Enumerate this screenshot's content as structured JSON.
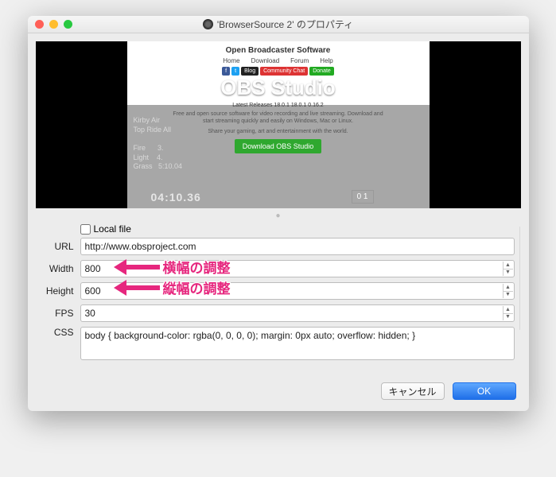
{
  "titlebar": {
    "title": "'BrowserSource 2' のプロパティ"
  },
  "preview": {
    "heading": "Open Broadcaster Software",
    "nav": [
      "Home",
      "Download",
      "Forum",
      "Help"
    ],
    "badges": [
      "f",
      "t",
      "Blog",
      "Community Chat",
      "Donate"
    ],
    "hero": "OBS Studio",
    "releases": "Latest Releases   18.0.1   18.0.1   0.16.2",
    "desc1": "Free and open source software for video recording and live streaming. Download and start streaming quickly and easily on Windows, Mac or Linux.",
    "desc2": "Share your gaming, art and entertainment with the world.",
    "download": "Download OBS Studio",
    "bg_lines": "Kirby Air\nTop Ride All\n\nFire      3.\nLight    4.\nGrass   5:10.04",
    "bg_time": "04:10.36",
    "bg_score": "0 1"
  },
  "form": {
    "local_file_label": "Local file",
    "labels": {
      "url": "URL",
      "width": "Width",
      "height": "Height",
      "fps": "FPS",
      "css": "CSS"
    },
    "url": "http://www.obsproject.com",
    "width": "800",
    "height": "600",
    "fps": "30",
    "css": "body { background-color: rgba(0, 0, 0, 0); margin: 0px auto; overflow: hidden; }"
  },
  "annotations": {
    "width": "横幅の調整",
    "height": "縦幅の調整"
  },
  "buttons": {
    "cancel": "キャンセル",
    "ok": "OK"
  }
}
